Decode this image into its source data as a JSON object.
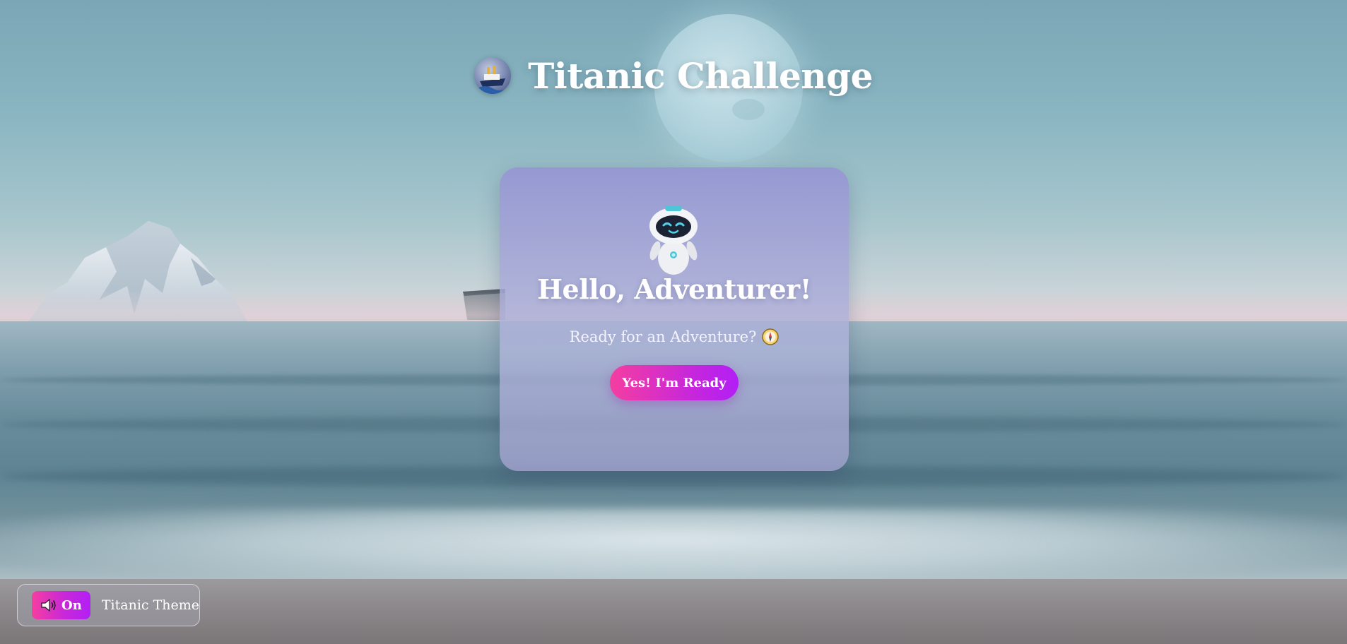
{
  "header": {
    "title": "Titanic Challenge",
    "logo_icon": "titanic-ship-logo"
  },
  "card": {
    "mascot_icon": "robot-icon",
    "title": "Hello, Adventurer!",
    "subtitle": "Ready for an Adventure?",
    "subtitle_icon": "compass-icon",
    "cta_label": "Yes! I'm Ready"
  },
  "sound": {
    "icon": "speaker-icon",
    "toggle_label": "On",
    "theme_label": "Titanic Theme"
  },
  "colors": {
    "accent_start": "#f53ea0",
    "accent_end": "#b21ff5",
    "card_bg": "#9b9fd4",
    "sky": "#7aa6b6"
  }
}
